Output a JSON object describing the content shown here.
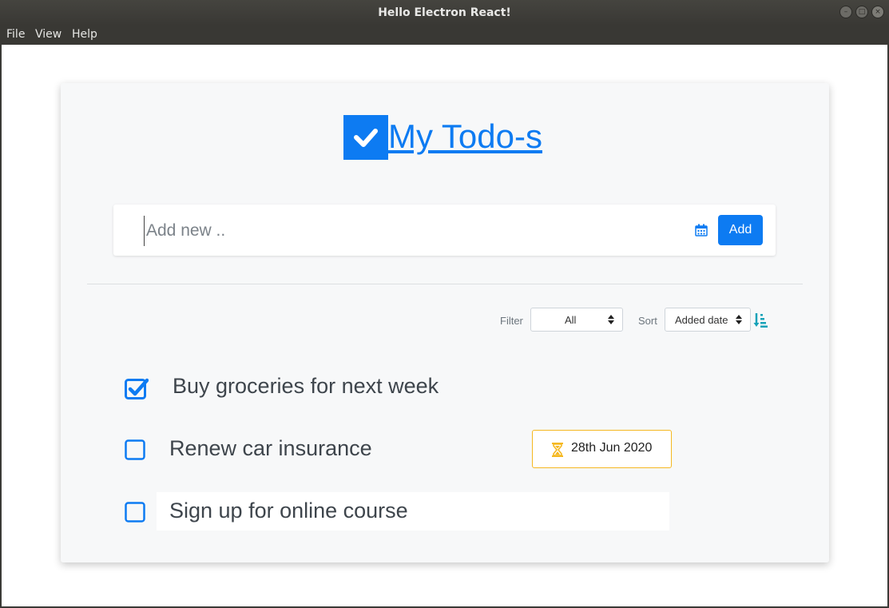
{
  "window": {
    "title": "Hello Electron React!"
  },
  "menu": {
    "items": [
      "File",
      "View",
      "Help"
    ]
  },
  "app": {
    "heading": "My Todo-s",
    "input_placeholder": "Add new ..",
    "add_label": "Add",
    "filter": {
      "label": "Filter",
      "selected": "All"
    },
    "sort": {
      "label": "Sort",
      "selected": "Added date"
    }
  },
  "todos": [
    {
      "text": "Buy groceries for next week",
      "done": true,
      "due": ""
    },
    {
      "text": "Renew car insurance",
      "done": false,
      "due": "28th Jun 2020"
    },
    {
      "text": "Sign up for online course",
      "done": false,
      "due": ""
    }
  ],
  "colors": {
    "accent": "#0d7bf2",
    "due_border": "#f5b821",
    "sort_icon": "#17a2b8"
  },
  "icons": [
    "check-logo-icon",
    "calendar-icon",
    "sort-ascending-icon",
    "checkbox-checked-icon",
    "checkbox-empty-icon",
    "hourglass-icon"
  ]
}
